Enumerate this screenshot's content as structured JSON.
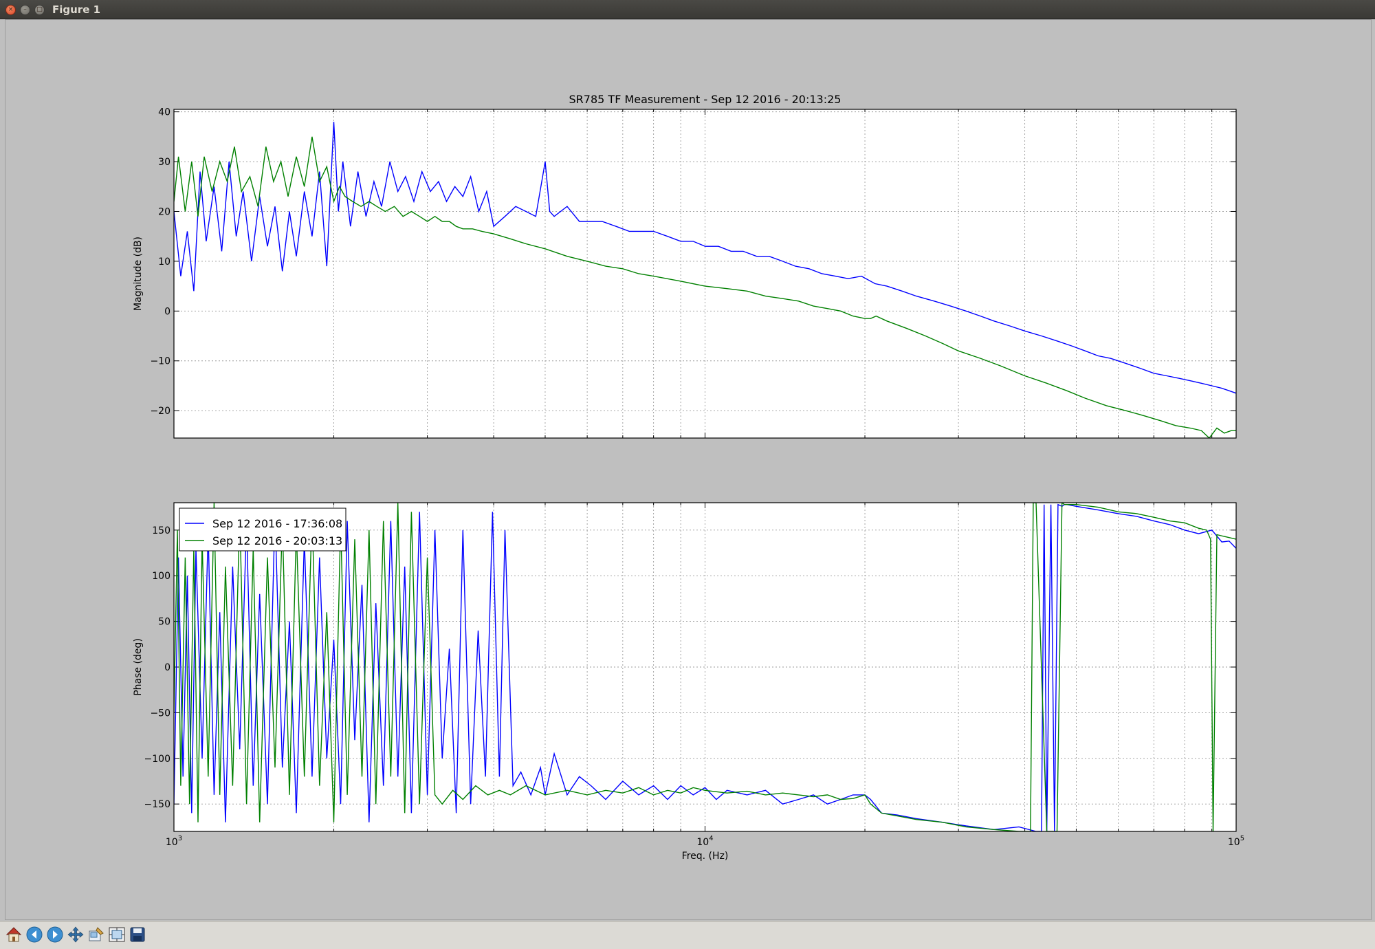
{
  "window": {
    "title": "Figure 1"
  },
  "toolbar": {
    "buttons": [
      {
        "name": "home-icon"
      },
      {
        "name": "back-icon"
      },
      {
        "name": "forward-icon"
      },
      {
        "name": "pan-icon"
      },
      {
        "name": "zoom-icon"
      },
      {
        "name": "subplots-icon"
      },
      {
        "name": "save-icon"
      }
    ]
  },
  "colors": {
    "series1": "#0000ff",
    "series2": "#008000",
    "grid": "#999999"
  },
  "chart_data": [
    {
      "type": "line",
      "title": "SR785 TF Measurement - Sep 12 2016 - 20:13:25",
      "xlabel": "",
      "ylabel": "Magnitude (dB)",
      "xscale": "log",
      "xlim": [
        1000,
        100000
      ],
      "ylim": [
        -25.5,
        40.5
      ],
      "yticks": [
        40,
        30,
        20,
        10,
        0,
        -10,
        -20
      ],
      "ytick_labels": [
        "40",
        "30",
        "20",
        "10",
        "0",
        "−10",
        "−20"
      ],
      "grid": true,
      "series": [
        {
          "name": "Sep 12 2016 - 17:36:08",
          "x": [
            1000,
            1030,
            1060,
            1090,
            1120,
            1150,
            1190,
            1230,
            1270,
            1310,
            1350,
            1400,
            1450,
            1500,
            1550,
            1600,
            1650,
            1700,
            1760,
            1820,
            1880,
            1940,
            2000,
            2040,
            2080,
            2150,
            2220,
            2300,
            2380,
            2460,
            2550,
            2640,
            2730,
            2830,
            2930,
            3040,
            3150,
            3260,
            3380,
            3500,
            3620,
            3750,
            3880,
            4000,
            4200,
            4400,
            4600,
            4800,
            5000,
            5100,
            5200,
            5500,
            5800,
            6100,
            6400,
            6800,
            7200,
            7600,
            8000,
            8500,
            9000,
            9500,
            10000,
            10600,
            11200,
            11800,
            12500,
            13200,
            14000,
            14800,
            15700,
            16600,
            17600,
            18600,
            19700,
            20900,
            22000,
            23500,
            25000,
            27000,
            29000,
            31000,
            33000,
            35000,
            37500,
            40000,
            43000,
            46000,
            49000,
            52000,
            55000,
            58000,
            62000,
            66000,
            70000,
            74000,
            78000,
            82000,
            86000,
            90000,
            94000,
            97000,
            100000
          ],
          "y": [
            20,
            7,
            16,
            4,
            28,
            14,
            25,
            12,
            30,
            15,
            24,
            10,
            23,
            13,
            21,
            8,
            20,
            11,
            24,
            15,
            28,
            9,
            38,
            20,
            30,
            17,
            28,
            19,
            26,
            21,
            30,
            24,
            27,
            22,
            28,
            24,
            26,
            22,
            25,
            23,
            27,
            20,
            24,
            17,
            19,
            21,
            20,
            19,
            30,
            20,
            19,
            21,
            18,
            18,
            18,
            17,
            16,
            16,
            16,
            15,
            14,
            14,
            13,
            13,
            12,
            12,
            11,
            11,
            10,
            9,
            8.5,
            7.5,
            7,
            6.5,
            7,
            5.5,
            5,
            4,
            3,
            2,
            1,
            0,
            -1,
            -2,
            -3,
            -4,
            -5,
            -6,
            -7,
            -8,
            -9,
            -9.5,
            -10.5,
            -11.5,
            -12.5,
            -13,
            -13.5,
            -14,
            -14.5,
            -15,
            -15.5,
            -16,
            -16.5
          ]
        },
        {
          "name": "Sep 12 2016 - 20:03:13",
          "x": [
            1000,
            1020,
            1050,
            1080,
            1110,
            1140,
            1180,
            1220,
            1260,
            1300,
            1340,
            1390,
            1440,
            1490,
            1540,
            1590,
            1640,
            1700,
            1760,
            1820,
            1880,
            1940,
            2000,
            2050,
            2100,
            2170,
            2250,
            2330,
            2410,
            2500,
            2600,
            2700,
            2800,
            2900,
            3000,
            3100,
            3200,
            3300,
            3400,
            3500,
            3650,
            3800,
            4000,
            4300,
            4600,
            5000,
            5500,
            6000,
            6500,
            7000,
            7500,
            8000,
            9000,
            10000,
            11000,
            12000,
            13000,
            14000,
            15000,
            16000,
            17000,
            18000,
            19000,
            20000,
            20500,
            21000,
            22000,
            24000,
            26000,
            28000,
            30000,
            33000,
            36000,
            40000,
            44000,
            48000,
            52000,
            57000,
            62000,
            67000,
            72000,
            77000,
            82000,
            86000,
            89000,
            92000,
            95000,
            98000,
            100000
          ],
          "y": [
            22,
            31,
            20,
            30,
            19,
            31,
            24,
            30,
            26,
            33,
            24,
            27,
            21,
            33,
            26,
            30,
            23,
            31,
            25,
            35,
            26,
            29,
            22,
            25,
            23,
            22,
            21,
            22,
            21,
            20,
            21,
            19,
            20,
            19,
            18,
            19,
            18,
            18,
            17,
            16.5,
            16.5,
            16,
            15.5,
            14.5,
            13.5,
            12.5,
            11,
            10,
            9,
            8.5,
            7.5,
            7,
            6,
            5,
            4.5,
            4,
            3,
            2.5,
            2,
            1,
            0.5,
            0,
            -1,
            -1.5,
            -1.5,
            -1,
            -2,
            -3.5,
            -5,
            -6.5,
            -8,
            -9.5,
            -11,
            -13,
            -14.5,
            -16,
            -17.5,
            -19,
            -20,
            -21,
            -22,
            -23,
            -23.5,
            -24,
            -25.5,
            -23.5,
            -24.5,
            -24,
            -24
          ]
        }
      ]
    },
    {
      "type": "line",
      "title": "",
      "xlabel": "Freq. (Hz)",
      "ylabel": "Phase (deg)",
      "xscale": "log",
      "xlim": [
        1000,
        100000
      ],
      "ylim": [
        -180,
        180
      ],
      "yticks": [
        150,
        100,
        50,
        0,
        -50,
        -100,
        -150
      ],
      "ytick_labels": [
        "150",
        "100",
        "50",
        "0",
        "−50",
        "−100",
        "−150"
      ],
      "xticks": [
        1000,
        10000,
        100000
      ],
      "xtick_labels": [
        {
          "base": "10",
          "exp": "3"
        },
        {
          "base": "10",
          "exp": "4"
        },
        {
          "base": "10",
          "exp": "5"
        }
      ],
      "grid": true,
      "legend": {
        "position": "upper-left",
        "entries": [
          "Sep 12 2016 - 17:36:08",
          "Sep 12 2016 - 20:03:13"
        ]
      },
      "series": [
        {
          "name": "Sep 12 2016 - 17:36:08",
          "x": [
            1000,
            1020,
            1040,
            1060,
            1080,
            1100,
            1130,
            1160,
            1190,
            1220,
            1250,
            1290,
            1330,
            1370,
            1410,
            1450,
            1500,
            1550,
            1600,
            1650,
            1700,
            1760,
            1820,
            1880,
            1940,
            2000,
            2060,
            2120,
            2190,
            2260,
            2330,
            2400,
            2480,
            2560,
            2640,
            2720,
            2800,
            2900,
            3000,
            3100,
            3200,
            3300,
            3400,
            3500,
            3620,
            3740,
            3860,
            3980,
            4100,
            4200,
            4350,
            4500,
            4700,
            4900,
            5000,
            5200,
            5500,
            5800,
            6100,
            6500,
            7000,
            7500,
            8000,
            8500,
            9000,
            9500,
            10000,
            10500,
            11000,
            12000,
            13000,
            14000,
            15000,
            16000,
            17000,
            18000,
            19000,
            20000,
            20500,
            21500,
            23000,
            25000,
            28000,
            31000,
            35000,
            39000,
            42000,
            43000,
            43500,
            44000,
            44800,
            45500,
            46200,
            47000,
            47500,
            48000,
            50000,
            55000,
            60000,
            65000,
            70000,
            75000,
            80000,
            85000,
            90000,
            94000,
            97000,
            100000
          ],
          "y": [
            -150,
            120,
            -120,
            100,
            -160,
            130,
            -100,
            150,
            -140,
            60,
            -170,
            110,
            -90,
            160,
            -130,
            80,
            -150,
            170,
            -110,
            50,
            -160,
            140,
            -120,
            120,
            -100,
            30,
            -150,
            160,
            -80,
            90,
            -170,
            70,
            -130,
            160,
            -120,
            110,
            -160,
            170,
            -140,
            150,
            -100,
            20,
            -160,
            150,
            -150,
            40,
            -120,
            170,
            -120,
            150,
            -130,
            -115,
            -140,
            -110,
            -140,
            -95,
            -140,
            -120,
            -130,
            -145,
            -125,
            -140,
            -130,
            -145,
            -130,
            -140,
            -132,
            -145,
            -135,
            -140,
            -135,
            -150,
            -145,
            -140,
            -150,
            -145,
            -140,
            -140,
            -145,
            -160,
            -162,
            -166,
            -170,
            -174,
            -178,
            -175,
            -180,
            -180,
            178,
            -180,
            178,
            -180,
            178,
            176,
            178,
            178,
            176,
            172,
            168,
            165,
            160,
            156,
            150,
            146,
            150,
            137,
            138,
            130
          ]
        },
        {
          "name": "Sep 12 2016 - 20:03:13",
          "x": [
            1000,
            1015,
            1030,
            1050,
            1070,
            1090,
            1110,
            1130,
            1160,
            1190,
            1220,
            1250,
            1290,
            1330,
            1370,
            1410,
            1450,
            1500,
            1550,
            1600,
            1650,
            1700,
            1760,
            1820,
            1880,
            1940,
            2000,
            2060,
            2120,
            2190,
            2260,
            2330,
            2400,
            2480,
            2560,
            2640,
            2720,
            2800,
            2900,
            3000,
            3100,
            3200,
            3350,
            3500,
            3700,
            3900,
            4100,
            4300,
            4600,
            5000,
            5500,
            6000,
            6500,
            7000,
            7500,
            8000,
            8500,
            9000,
            9500,
            10000,
            11000,
            12000,
            13000,
            14000,
            15000,
            16000,
            17000,
            18000,
            19000,
            20000,
            20500,
            21500,
            23000,
            25000,
            28000,
            31000,
            35000,
            39000,
            41000,
            41500,
            42000,
            44000,
            46000,
            47000,
            47500,
            48000,
            50000,
            55000,
            60000,
            65000,
            70000,
            75000,
            80000,
            85000,
            88000,
            89500,
            90500,
            92000,
            95000,
            100000
          ],
          "y": [
            -50,
            150,
            -130,
            120,
            -150,
            130,
            -170,
            140,
            -120,
            180,
            -140,
            110,
            -130,
            170,
            -150,
            130,
            -170,
            120,
            -110,
            160,
            -140,
            150,
            -120,
            170,
            -130,
            60,
            -170,
            160,
            -140,
            140,
            -120,
            150,
            -150,
            160,
            -120,
            180,
            -160,
            170,
            -150,
            120,
            -140,
            -150,
            -135,
            -145,
            -130,
            -140,
            -135,
            -140,
            -130,
            -140,
            -135,
            -140,
            -135,
            -138,
            -132,
            -140,
            -135,
            -138,
            -132,
            -135,
            -138,
            -136,
            -140,
            -138,
            -140,
            -142,
            -140,
            -145,
            -144,
            -140,
            -150,
            -160,
            -163,
            -167,
            -170,
            -175,
            -178,
            -180,
            -180,
            180,
            180,
            -180,
            -180,
            180,
            178,
            178,
            178,
            175,
            170,
            168,
            164,
            160,
            158,
            152,
            150,
            140,
            -180,
            145,
            143,
            140
          ]
        }
      ]
    }
  ]
}
